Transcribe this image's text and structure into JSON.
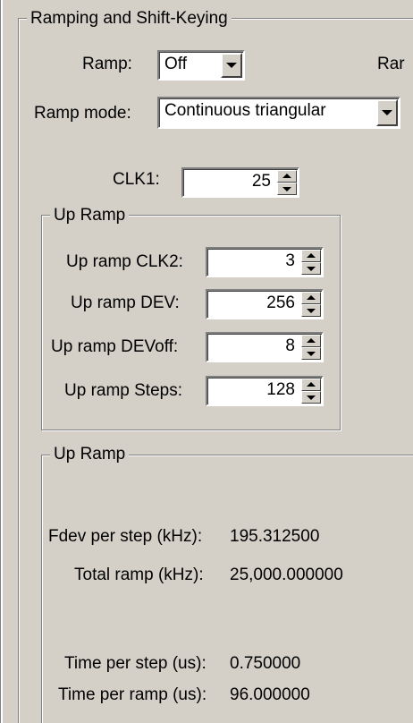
{
  "ramping_group": {
    "title": "Ramping and Shift-Keying",
    "ramp_label": "Ramp:",
    "ramp_value": "Off",
    "right_cut_label": "Rar",
    "ramp_mode_label": "Ramp mode:",
    "ramp_mode_value": "Continuous triangular",
    "clk1_label": "CLK1:",
    "clk1_value": "25"
  },
  "up_ramp_inputs": {
    "title": "Up Ramp",
    "clk2_label": "Up ramp CLK2:",
    "clk2_value": "3",
    "dev_label": "Up ramp DEV:",
    "dev_value": "256",
    "devoff_label": "Up ramp DEVoff:",
    "devoff_value": "8",
    "steps_label": "Up ramp Steps:",
    "steps_value": "128"
  },
  "up_ramp_results": {
    "title": "Up Ramp",
    "fdev_label": "Fdev per step (kHz):",
    "fdev_value": "195.312500",
    "total_label": "Total ramp (kHz):",
    "total_value": "25,000.000000",
    "time_step_label": "Time per step (us):",
    "time_step_value": "0.750000",
    "time_ramp_label": "Time per ramp (us):",
    "time_ramp_value": "96.000000"
  }
}
